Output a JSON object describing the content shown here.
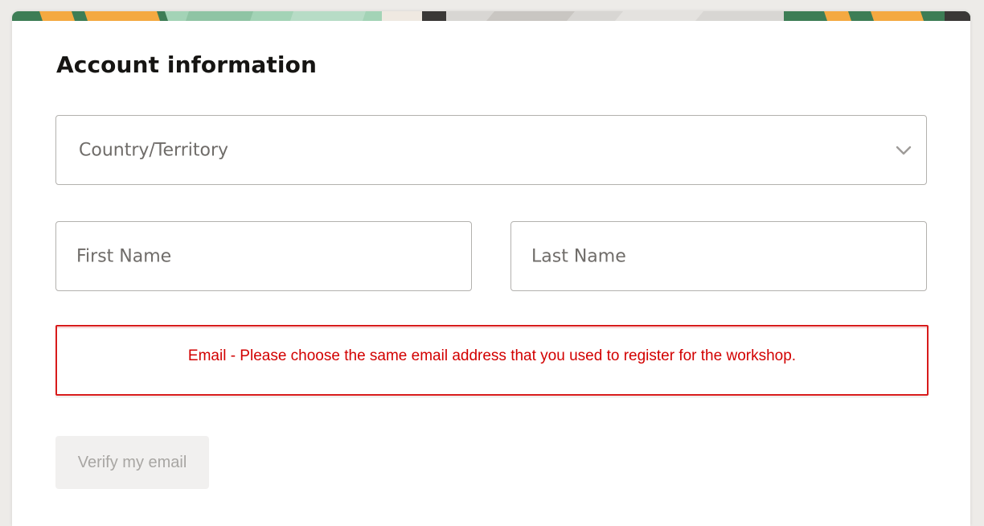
{
  "form": {
    "title": "Account information",
    "country": {
      "placeholder": "Country/Territory"
    },
    "first_name": {
      "placeholder": "First Name"
    },
    "last_name": {
      "placeholder": "Last Name"
    },
    "email": {
      "message": "Email - Please choose the same email address that you used to register for the workshop."
    },
    "verify_button": {
      "label": "Verify my email"
    }
  },
  "colors": {
    "page_background": "#edebe8",
    "error_red": "#d20000",
    "banner_green": "#3d7d55",
    "banner_orange": "#f4a941",
    "banner_mint": "#a3d3b6"
  },
  "icons": {
    "country_dropdown": "chevron-down-icon"
  }
}
